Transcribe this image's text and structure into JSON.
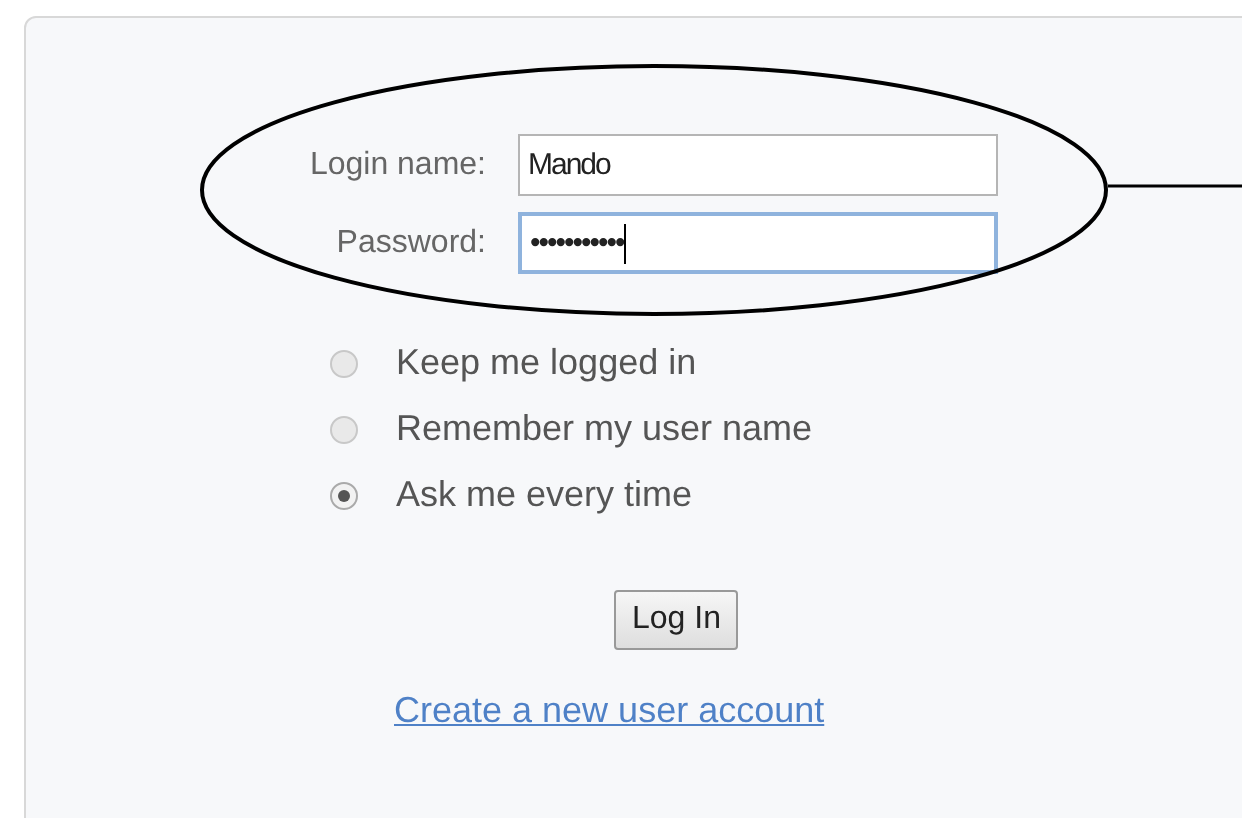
{
  "fields": [
    {
      "label": "Login name:",
      "value": "Mando",
      "focused": false
    },
    {
      "label": "Password:",
      "value": "•••••••••••",
      "focused": true
    }
  ],
  "options": [
    {
      "label": "Keep me logged in",
      "selected": false
    },
    {
      "label": "Remember my user name",
      "selected": false
    },
    {
      "label": "Ask me every time",
      "selected": true
    }
  ],
  "button": "Log In",
  "link": "Create a new user account"
}
